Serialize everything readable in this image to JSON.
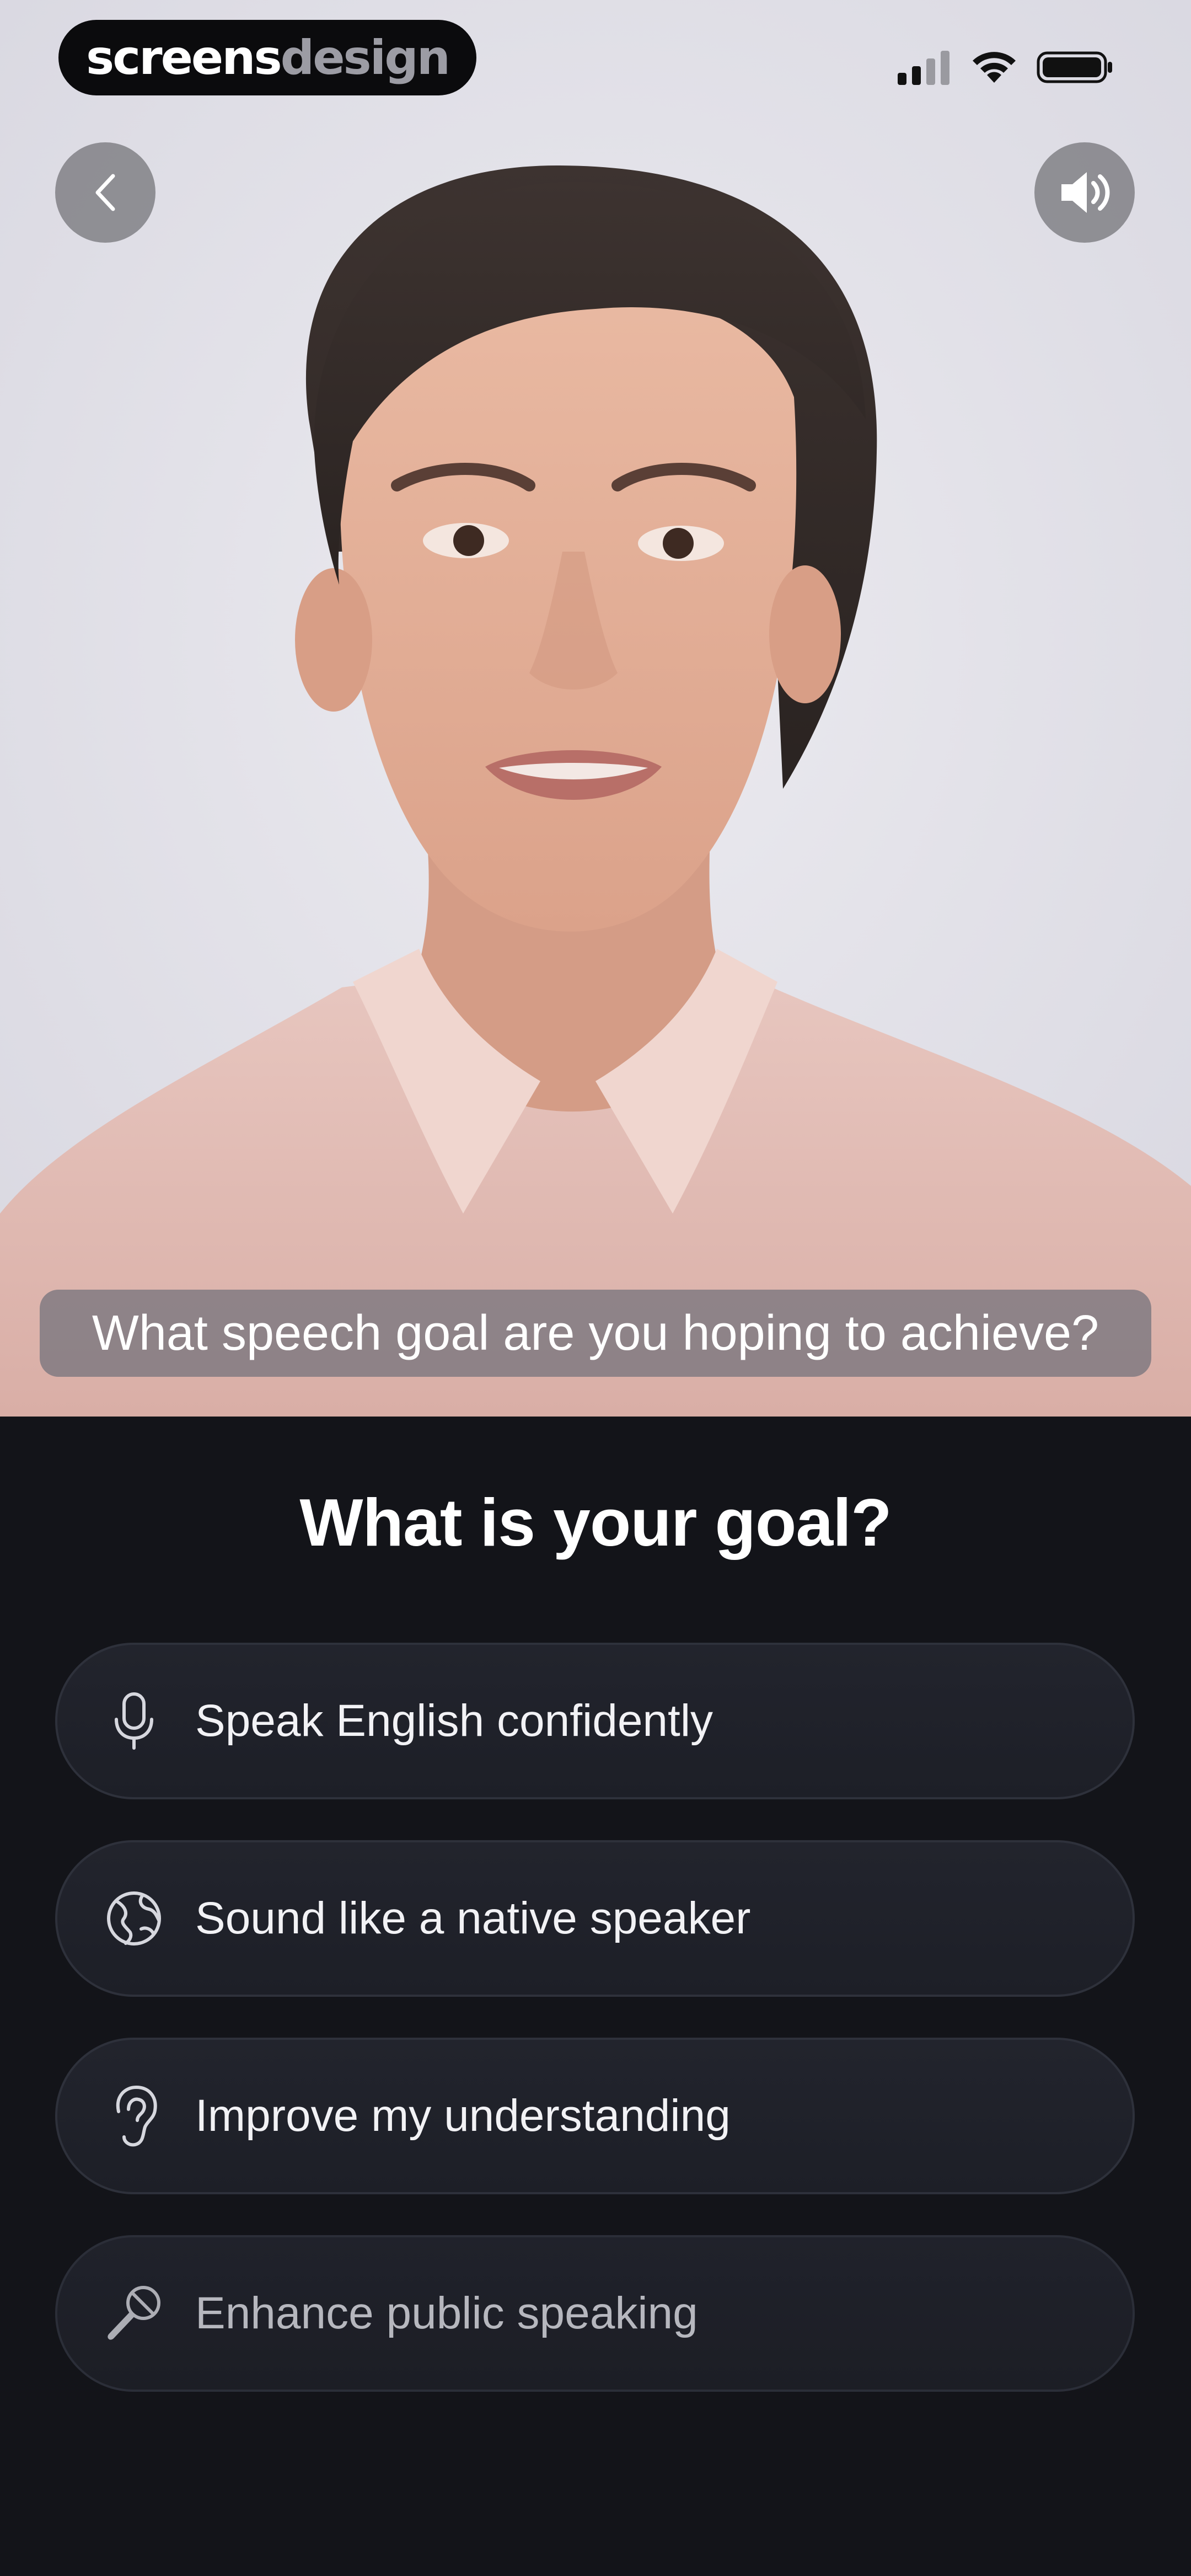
{
  "status_bar": {
    "brand_part1": "screens",
    "brand_part2": "design"
  },
  "video": {
    "caption": "What speech goal are you hoping to achieve?",
    "back_icon": "chevron-left-icon",
    "sound_icon": "speaker-volume-icon"
  },
  "question": {
    "title": "What is your goal?"
  },
  "options": [
    {
      "label": "Speak English confidently",
      "icon": "microphone-icon"
    },
    {
      "label": "Sound like a native speaker",
      "icon": "globe-icon"
    },
    {
      "label": "Improve my understanding",
      "icon": "ear-icon"
    },
    {
      "label": "Enhance public speaking",
      "icon": "handheld-mic-icon"
    }
  ],
  "colors": {
    "background": "#131419",
    "option_bg": "#1f2129",
    "option_border": "#2e313b",
    "text": "#ffffff"
  }
}
